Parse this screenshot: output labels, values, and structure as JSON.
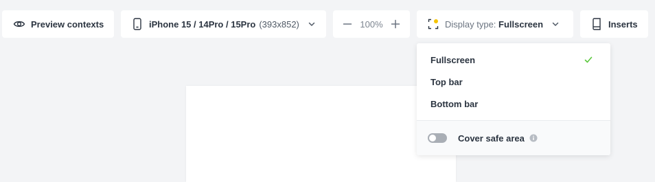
{
  "toolbar": {
    "preview": {
      "label": "Preview contexts",
      "icon": "eye-icon"
    },
    "device": {
      "name": "iPhone 15 / 14Pro / 15Pro",
      "dims": "(393x852)",
      "icon": "phone-icon"
    },
    "zoom": {
      "value": "100%"
    },
    "display_type": {
      "prefix": "Display type:",
      "value": "Fullscreen",
      "icon": "display-type-icon"
    },
    "inserts": {
      "label": "Inserts",
      "icon": "book-icon"
    }
  },
  "dropdown": {
    "options": [
      {
        "label": "Fullscreen",
        "selected": true
      },
      {
        "label": "Top bar",
        "selected": false
      },
      {
        "label": "Bottom bar",
        "selected": false
      }
    ],
    "cover_safe_area": {
      "label": "Cover safe area",
      "enabled": false
    }
  },
  "colors": {
    "background": "#f3f4f6",
    "accent_green": "#5cc83e",
    "accent_yellow": "#f5c400",
    "text_primary": "#2b3440"
  }
}
